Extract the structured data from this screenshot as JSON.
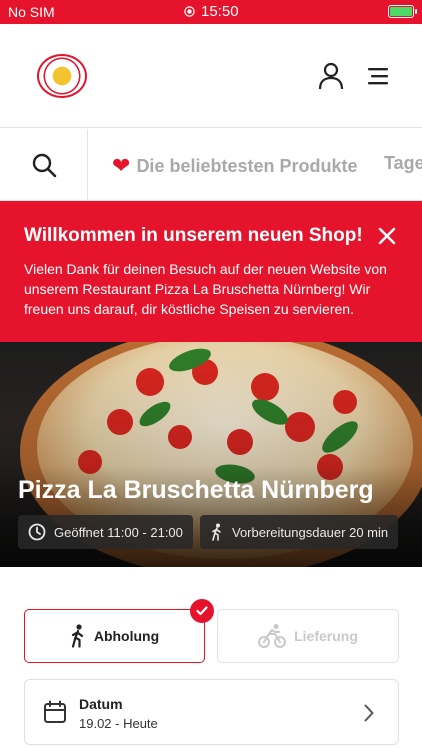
{
  "status_bar": {
    "carrier": "No SIM",
    "time": "15:50"
  },
  "nav": {
    "categories": [
      "Die beliebtesten Produkte",
      "Tage"
    ]
  },
  "banner": {
    "title": "Willkommen in unserem neuen Shop!",
    "text": "Vielen Dank für deinen Besuch auf der neuen Website von unserem Restaurant Pizza La Bruschetta Nürnberg! Wir freuen uns darauf, dir köstliche Speisen zu servieren."
  },
  "hero": {
    "title": "Pizza La Bruschetta Nürnberg",
    "opening": "Geöffnet 11:00 - 21:00",
    "prep_time": "Vorbereitungsdauer 20 min"
  },
  "order_mode": {
    "pickup": "Abholung",
    "delivery": "Lieferung"
  },
  "date": {
    "label": "Datum",
    "value": "19.02 - Heute"
  },
  "colors": {
    "brand_red": "#e5132b",
    "battery_green": "#4cd964"
  },
  "icons": [
    "user-icon",
    "menu-icon",
    "search-icon",
    "heart-icon",
    "close-icon",
    "clock-icon",
    "walking-icon",
    "bicycle-icon",
    "check-icon",
    "calendar-icon",
    "chevron-right-icon"
  ]
}
